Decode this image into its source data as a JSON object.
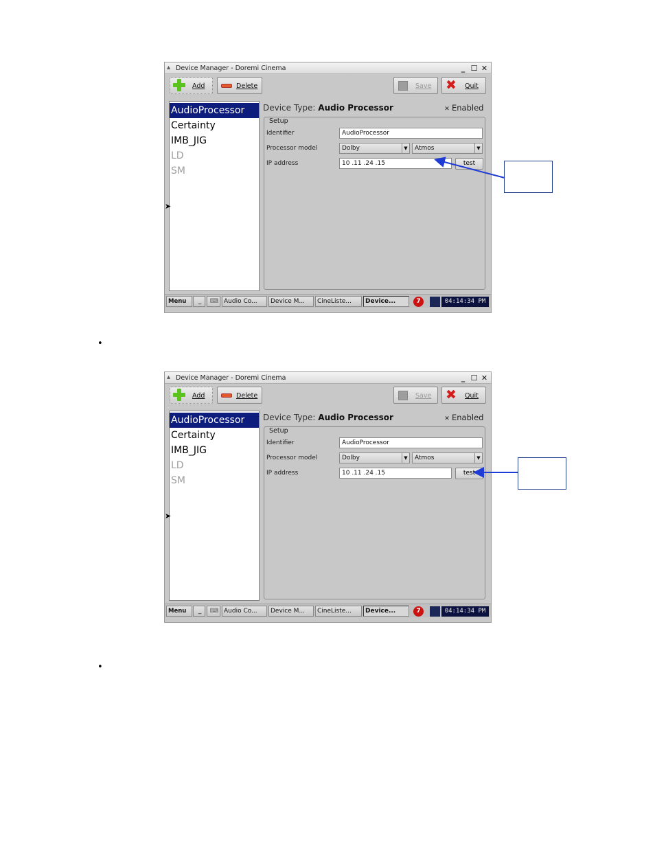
{
  "screenshots": [
    {
      "window": {
        "title": "Device Manager - Doremi Cinema",
        "icon": "app-icon",
        "controls": [
          "_",
          "☐",
          "✕"
        ]
      },
      "toolbar": {
        "add_label": "Add",
        "delete_label": "Delete",
        "save_label": "Save",
        "quit_label": "Quit"
      },
      "device_list": [
        {
          "label": "AudioProcessor",
          "state": "selected"
        },
        {
          "label": "Certainty",
          "state": "normal"
        },
        {
          "label": "IMB_JIG",
          "state": "normal"
        },
        {
          "label": "LD",
          "state": "disabled"
        },
        {
          "label": "SM",
          "state": "disabled"
        }
      ],
      "detail": {
        "device_type_prefix": "Device Type:",
        "device_type_value": "Audio Processor",
        "enabled_label": "Enabled",
        "enabled_mark": "✕",
        "setup_legend": "Setup",
        "identifier_label": "Identifier",
        "identifier_value": "AudioProcessor",
        "processor_model_label": "Processor model",
        "processor_model_value": "Dolby",
        "processor_submodel_value": "Atmos",
        "ip_label": "IP address",
        "ip_value": "10 .11 .24 .15",
        "test_label": "test"
      },
      "taskbar": {
        "menu": "Menu",
        "minimize": "_",
        "keyboard": "⌨",
        "items": [
          "Audio Co...",
          "Device M...",
          "CineListe...",
          "Device..."
        ],
        "badge": "7",
        "clock": "04:14:34 PM"
      }
    },
    {
      "window": {
        "title": "Device Manager - Doremi Cinema",
        "icon": "app-icon",
        "controls": [
          "_",
          "☐",
          "✕"
        ]
      },
      "toolbar": {
        "add_label": "Add",
        "delete_label": "Delete",
        "save_label": "Save",
        "quit_label": "Quit"
      },
      "device_list": [
        {
          "label": "AudioProcessor",
          "state": "selected"
        },
        {
          "label": "Certainty",
          "state": "normal"
        },
        {
          "label": "IMB_JIG",
          "state": "normal"
        },
        {
          "label": "LD",
          "state": "disabled"
        },
        {
          "label": "SM",
          "state": "disabled"
        }
      ],
      "detail": {
        "device_type_prefix": "Device Type:",
        "device_type_value": "Audio Processor",
        "enabled_label": "Enabled",
        "enabled_mark": "✕",
        "setup_legend": "Setup",
        "identifier_label": "Identifier",
        "identifier_value": "AudioProcessor",
        "processor_model_label": "Processor model",
        "processor_model_value": "Dolby",
        "processor_submodel_value": "Atmos",
        "ip_label": "IP address",
        "ip_value": "10 .11 .24 .15",
        "test_label": "test"
      },
      "taskbar": {
        "menu": "Menu",
        "minimize": "_",
        "keyboard": "⌨",
        "items": [
          "Audio Co...",
          "Device M...",
          "CineListe...",
          "Device..."
        ],
        "badge": "7",
        "clock": "04:14:34 PM"
      }
    }
  ],
  "bullets": [
    "•",
    "•"
  ],
  "colors": {
    "selection": "#0d1d7e",
    "callout_arrow": "#1f3bd6",
    "quit_icon": "#d41e1e",
    "add_icon": "#5cc21e",
    "delete_icon": "#e05a2a"
  },
  "icons": {
    "add": "plus-icon",
    "delete": "minus-icon",
    "save": "save-icon",
    "quit": "x-icon",
    "cursor": "mouse-cursor-icon"
  }
}
